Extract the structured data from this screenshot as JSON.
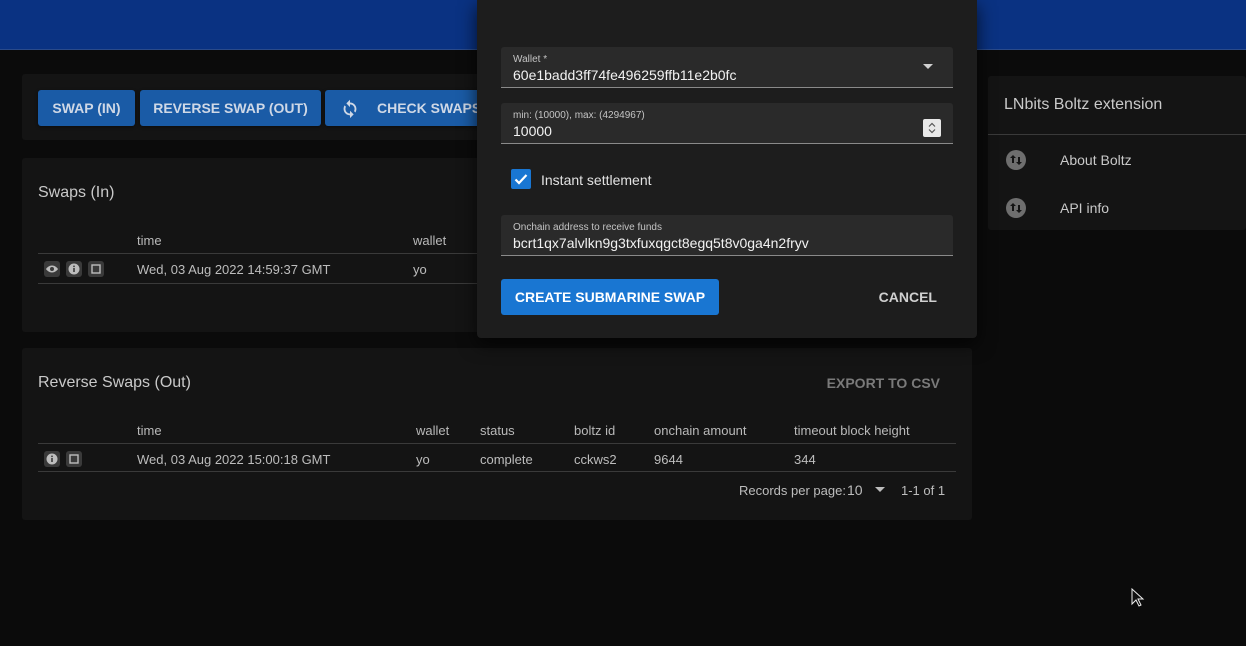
{
  "toolbar": {
    "swap_in": "SWAP (IN)",
    "reverse_swap_out": "REVERSE SWAP (OUT)",
    "check_swaps": "CHECK SWAPS"
  },
  "swaps_in": {
    "title": "Swaps (In)",
    "columns": [
      "time",
      "wallet"
    ],
    "rows": [
      {
        "time": "Wed, 03 Aug 2022 14:59:37 GMT",
        "wallet": "yo"
      }
    ]
  },
  "reverse_swaps": {
    "title": "Reverse Swaps (Out)",
    "export_label": "EXPORT TO CSV",
    "columns": [
      "time",
      "wallet",
      "status",
      "boltz id",
      "onchain amount",
      "timeout block height"
    ],
    "rows": [
      {
        "time": "Wed, 03 Aug 2022 15:00:18 GMT",
        "wallet": "yo",
        "status": "complete",
        "boltz_id": "cckws2",
        "onchain_amount": "9644",
        "timeout_block_height": "344"
      }
    ],
    "pagination": {
      "records_label": "Records per page:",
      "records_value": "10",
      "range": "1-1 of 1"
    }
  },
  "sidebar": {
    "title": "LNbits Boltz extension",
    "items": [
      {
        "label": "About Boltz",
        "icon": "swap-vertical-icon"
      },
      {
        "label": "API info",
        "icon": "swap-vertical-icon"
      }
    ]
  },
  "dialog": {
    "wallet_label": "Wallet *",
    "wallet_value": "60e1badd3ff74fe496259ffb11e2b0fc",
    "amount_label": "min: (10000), max: (4294967)",
    "amount_value": "10000",
    "instant_label": "Instant settlement",
    "instant_checked": true,
    "address_label": "Onchain address to receive funds",
    "address_value": "bcrt1qx7alvlkn9g3txfuxqgct8egq5t8v0ga4n2fryv",
    "create_label": "CREATE SUBMARINE SWAP",
    "cancel_label": "CANCEL"
  },
  "colors": {
    "header": "#0a3282",
    "primary": "#1976d2",
    "toolbar_button": "#1a5ba6"
  }
}
